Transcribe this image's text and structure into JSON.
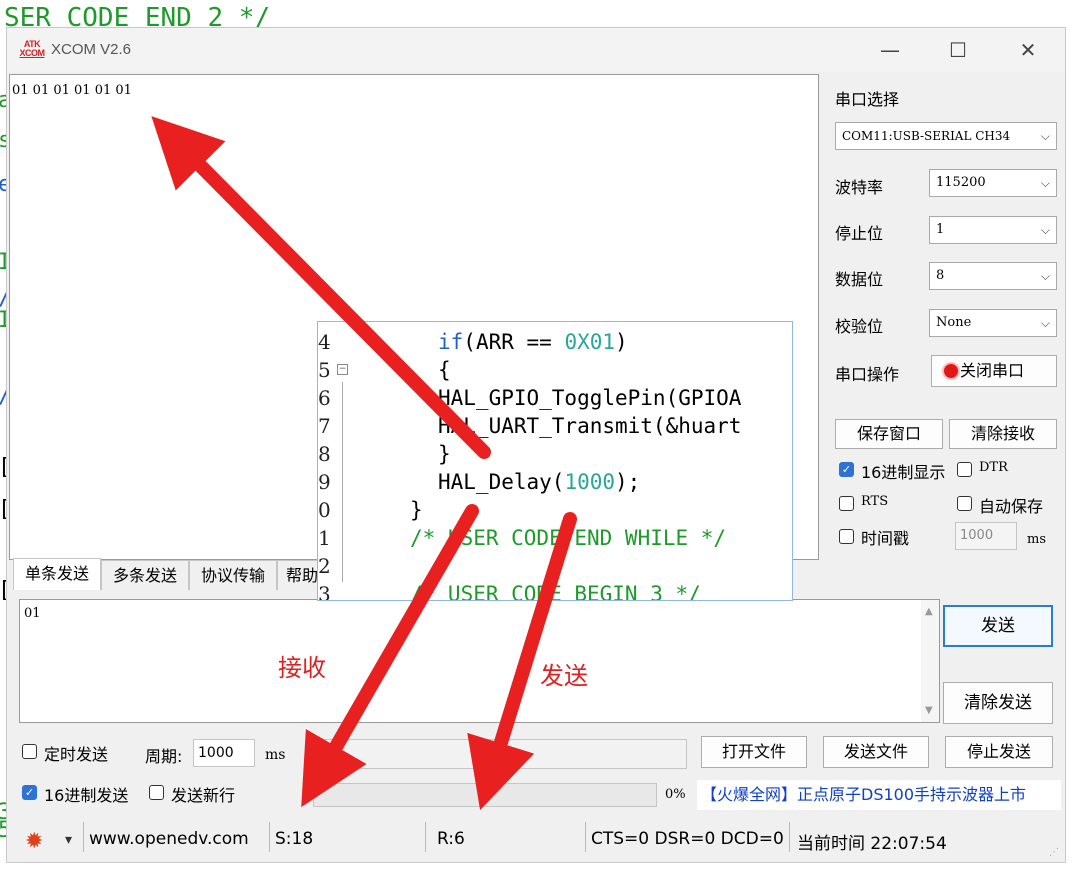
{
  "background": {
    "code_line": "SER CODE END 2 */",
    "edge_chars": [
      "a",
      "s",
      "e",
      "I",
      "/",
      "I",
      "/",
      "[",
      "[",
      "[",
      "3",
      "5"
    ]
  },
  "window": {
    "title": "XCOM V2.6",
    "logo_text": [
      "ATK",
      "XCOM"
    ],
    "minimize_glyph": "—",
    "maximize_glyph": "☐",
    "close_glyph": "✕"
  },
  "receive": {
    "text": "01 01 01 01 01 01"
  },
  "panel": {
    "port_select_label": "串口选择",
    "port_value": "COM11:USB-SERIAL CH34",
    "baud_label": "波特率",
    "baud_value": "115200",
    "stopbits_label": "停止位",
    "stopbits_value": "1",
    "databits_label": "数据位",
    "databits_value": "8",
    "parity_label": "校验位",
    "parity_value": "None",
    "port_op_label": "串口操作",
    "close_port_button": "关闭串口",
    "save_window_button": "保存窗口",
    "clear_receive_button": "清除接收",
    "hex_display_label": "16进制显示",
    "hex_display_checked": true,
    "dtr_label": "DTR",
    "dtr_checked": false,
    "rts_label": "RTS",
    "rts_checked": false,
    "auto_save_label": "自动保存",
    "auto_save_checked": false,
    "timestamp_label": "时间戳",
    "timestamp_checked": false,
    "timestamp_value": "1000",
    "timestamp_unit": "ms",
    "dropdown_arrow": "⌵"
  },
  "tabs": [
    "单条发送",
    "多条发送",
    "协议传输",
    "帮助"
  ],
  "send": {
    "text": "01",
    "send_button": "发送",
    "clear_send_button": "清除发送",
    "timed_send_label": "定时发送",
    "timed_send_checked": false,
    "period_label": "周期:",
    "period_value": "1000",
    "period_unit": "ms",
    "open_file_button": "打开文件",
    "send_file_button": "发送文件",
    "stop_send_button": "停止发送",
    "hex_send_label": "16进制发送",
    "hex_send_checked": true,
    "newline_label": "发送新行",
    "newline_checked": false,
    "progress_percent_text": "0%",
    "progress_fraction": 0,
    "ad_text": "【火爆全网】正点原子DS100手持示波器上市"
  },
  "status": {
    "menu_arrow": "▾",
    "website": "www.openedv.com",
    "sent": "S:18",
    "received": "R:6",
    "lines": "CTS=0 DSR=0 DCD=0",
    "time": "当前时间 22:07:54"
  },
  "code": {
    "lines": [
      {
        "num": "4",
        "text": "if(ARR == 0X01)"
      },
      {
        "num": "5",
        "text": "{"
      },
      {
        "num": "6",
        "text": "HAL_GPIO_TogglePin(GPIOA"
      },
      {
        "num": "7",
        "text": "HAL_UART_Transmit(&huart"
      },
      {
        "num": "8",
        "text": "}"
      },
      {
        "num": "9",
        "text": "HAL_Delay(1000);"
      },
      {
        "num": "0",
        "text": "}"
      },
      {
        "num": "1",
        "text": "/* USER CODE END WHILE */"
      },
      {
        "num": "2",
        "text": ""
      },
      {
        "num": "3",
        "text": "/* USER CODE BEGIN 3 */"
      }
    ]
  },
  "annotations": {
    "receive": "接收",
    "send": "发送"
  },
  "colors": {
    "arrow": "#e82020",
    "accent": "#2f72d6",
    "comment": "#1e9a2a",
    "keyword": "#2060c8",
    "number": "#2aa59a"
  }
}
